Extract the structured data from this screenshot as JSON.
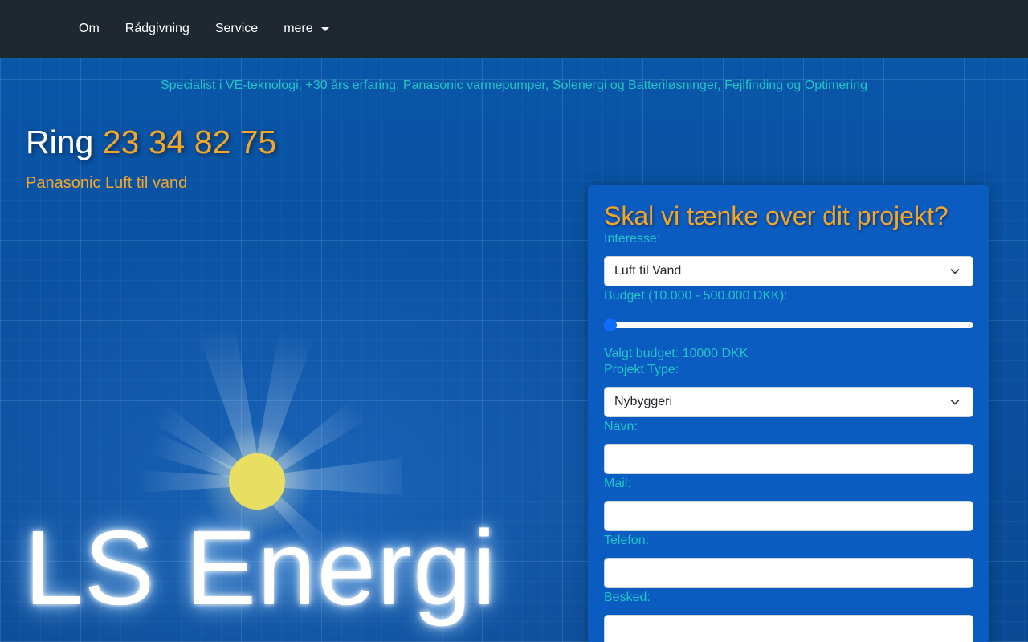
{
  "nav": {
    "items": [
      "Om",
      "Rådgivning",
      "Service"
    ],
    "more_label": "mere"
  },
  "hero": {
    "tagline": "Specialist i VE-teknologi, +30 års erfaring, Panasonic varmepumper, Solenergi og Batteriløsninger, Fejlfinding og Optimering",
    "phone_prefix": "Ring",
    "phone_number": "23 34 82 75",
    "product": "Panasonic Luft til vand",
    "logo_text": "LS Energi"
  },
  "form": {
    "title": "Skal vi tænke over dit projekt?",
    "interest_label": "Interesse:",
    "interest_value": "Luft til Vand",
    "budget_label": "Budget (10.000 - 500.000 DKK):",
    "budget_min": 10000,
    "budget_max": 500000,
    "budget_value": 10000,
    "budget_output": "Valgt budget: 10000 DKK",
    "project_type_label": "Projekt Type:",
    "project_type_value": "Nybyggeri",
    "name_label": "Navn:",
    "name_value": "",
    "mail_label": "Mail:",
    "mail_value": "",
    "phone_label": "Telefon:",
    "phone_value": "",
    "message_label": "Besked:",
    "message_value": ""
  },
  "colors": {
    "accent_orange": "#f4a62a",
    "accent_teal": "#22c4c8",
    "navbar_bg": "#1f2730",
    "slider_thumb": "#0d6efd"
  }
}
